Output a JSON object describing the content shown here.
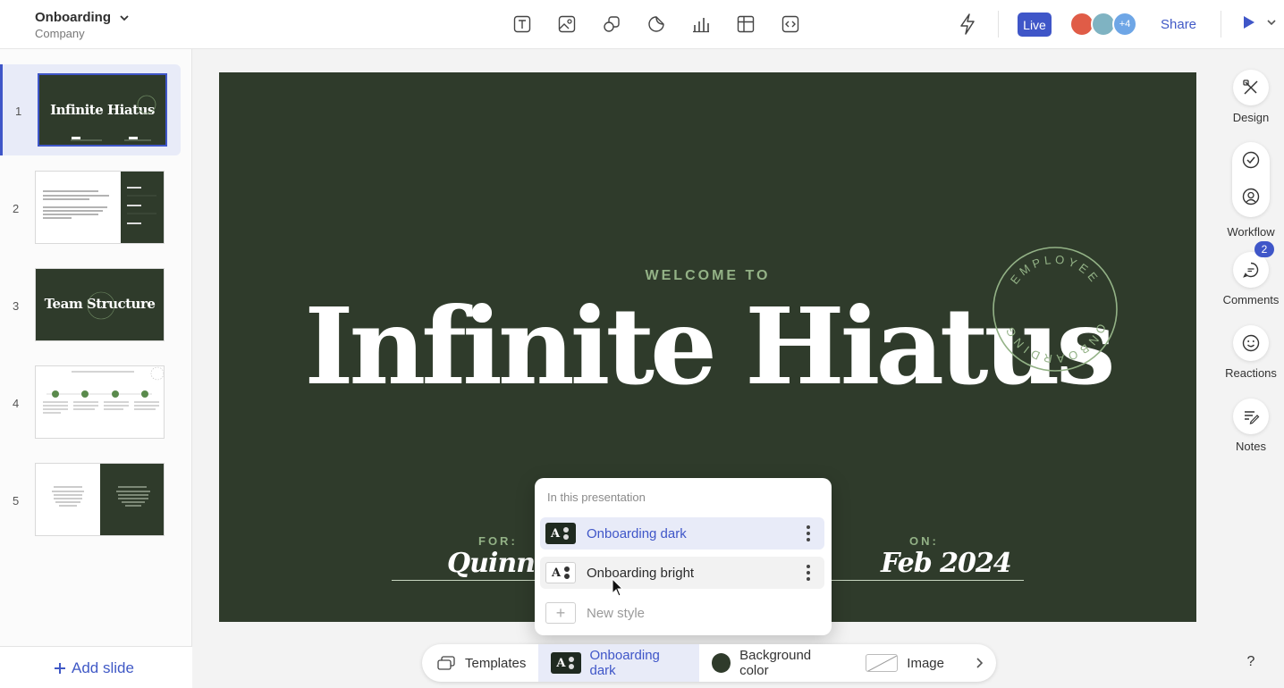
{
  "header": {
    "doc_title": "Onboarding",
    "doc_subtitle": "Company",
    "tools": [
      "text-icon",
      "image-icon",
      "shapes-icon",
      "sticker-icon",
      "chart-icon",
      "table-icon",
      "embed-icon"
    ],
    "live_label": "Live",
    "avatars_more": "+4",
    "share_label": "Share"
  },
  "sidebar": {
    "slides": [
      {
        "number": "1",
        "thumb_title": "Infinite Hiatus"
      },
      {
        "number": "2",
        "thumb_title": ""
      },
      {
        "number": "3",
        "thumb_title": "Team Structure"
      },
      {
        "number": "4",
        "thumb_title": ""
      },
      {
        "number": "5",
        "thumb_title": ""
      }
    ],
    "add_slide_label": "Add slide"
  },
  "slide": {
    "welcome": "WELCOME TO",
    "title": "Infinite Hiatus",
    "stamp_top": "EMPLOYEE",
    "stamp_bottom": "ONBOARDING",
    "for_label": "FOR:",
    "for_value": "Quinn S.",
    "on_label": "ON:",
    "on_value": "Feb 2024"
  },
  "style_popup": {
    "heading": "In this presentation",
    "styles": [
      {
        "label": "Onboarding dark",
        "selected": true
      },
      {
        "label": "Onboarding bright",
        "selected": false
      }
    ],
    "new_style_label": "New style"
  },
  "right_rail": {
    "design_label": "Design",
    "workflow_label": "Workflow",
    "comments_label": "Comments",
    "comments_count": "2",
    "reactions_label": "Reactions",
    "notes_label": "Notes"
  },
  "bottom_toolbar": {
    "templates_label": "Templates",
    "style_label": "Onboarding dark",
    "background_label": "Background color",
    "image_label": "Image"
  },
  "help_label": "?",
  "colors": {
    "accent": "#3f56c8",
    "slide_bg": "#2f3b2b",
    "slide_accent": "#93b286"
  }
}
